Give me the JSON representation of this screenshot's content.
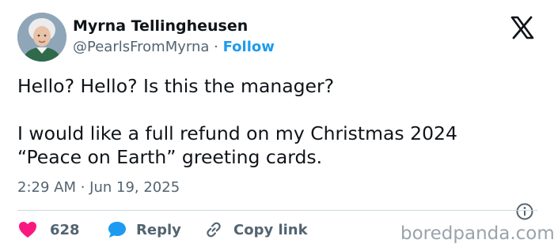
{
  "author": {
    "name": "Myrna Tellingheusen",
    "handle": "@PearlsFromMyrna",
    "separator": "·",
    "follow_label": "Follow"
  },
  "icons": {
    "platform": "x-logo-icon",
    "info": "info-icon",
    "like": "heart-icon",
    "reply": "speech-bubble-icon",
    "copy": "link-icon"
  },
  "tweet": {
    "line1": "Hello? Hello? Is this the manager?",
    "line2": "I would like a full refund on my Christmas 2024",
    "line3": "“Peace on Earth” greeting cards.",
    "timestamp": "2:29 AM · Jun 19, 2025"
  },
  "actions": {
    "likes_count": "628",
    "reply_label": "Reply",
    "copy_label": "Copy link"
  },
  "watermark": "boredpanda.com",
  "colors": {
    "accent": "#1d9bf0",
    "like": "#f91880",
    "text": "#0f1419",
    "muted": "#536471"
  }
}
